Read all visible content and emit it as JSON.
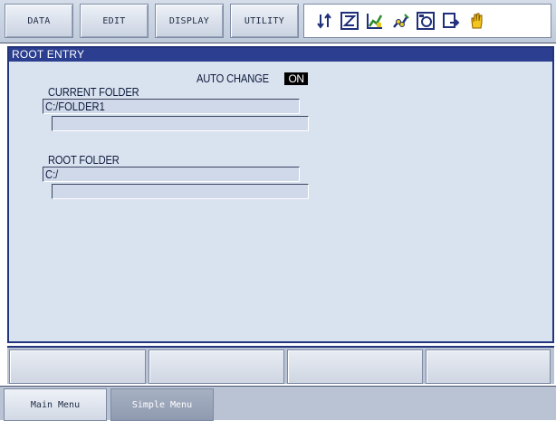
{
  "menu": {
    "items": [
      {
        "label": "DATA"
      },
      {
        "label": "EDIT"
      },
      {
        "label": "DISPLAY"
      },
      {
        "label": "UTILITY"
      }
    ]
  },
  "status_icons": [
    "two-way-arrows-icon",
    "z-box-icon",
    "graph-icon",
    "robot-icon",
    "circle-icon",
    "arrow-out-icon",
    "hand-icon"
  ],
  "window": {
    "title": "ROOT ENTRY",
    "auto_change_label": "AUTO CHANGE",
    "auto_change_value": "ON",
    "current_folder": {
      "label": "CURRENT FOLDER",
      "value": "C:/FOLDER1",
      "value2": ""
    },
    "root_folder": {
      "label": "ROOT FOLDER",
      "value": "C:/",
      "value2": ""
    }
  },
  "bottom_tabs": {
    "main": "Main Menu",
    "simple": "Simple Menu"
  },
  "colors": {
    "titlebar": "#2b3e8f",
    "window_bg": "#d9e2ef",
    "field_bg": "#cfd9ea"
  }
}
